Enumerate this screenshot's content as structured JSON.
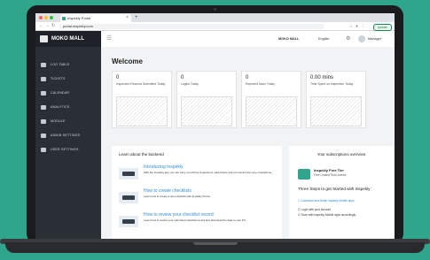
{
  "browser": {
    "tab_title": "Inspekly Portal",
    "url": "portal.inspekly.com",
    "update_label": "Update"
  },
  "app": {
    "brand_name": "MOKO MALL",
    "topbar": {
      "mall": "MOKO MALL",
      "language": "English",
      "user": "Manager"
    },
    "sidebar": [
      {
        "label": "LOG TABLE"
      },
      {
        "label": "TICKETS"
      },
      {
        "label": "CALENDAR"
      },
      {
        "label": "ANALYTICS"
      },
      {
        "label": "MODULE"
      },
      {
        "label": "ADMIN SETTINGS"
      },
      {
        "label": "USER SETTINGS"
      }
    ]
  },
  "main": {
    "welcome": "Welcome",
    "stats": [
      {
        "value": "0",
        "label": "Inspection Records Submitted Today"
      },
      {
        "value": "0",
        "label": "Logins Today"
      },
      {
        "value": "0",
        "label": "Reported Issue Today"
      },
      {
        "value": "0.00 mins",
        "label": "Time Spent on Inspection Today"
      }
    ],
    "learn": {
      "title": "Learn about the backend",
      "items": [
        {
          "title": "Introducing Inspekly",
          "desc": "With the Inspekly app you can carry out off line inspections, add photos and comments from any smartphone."
        },
        {
          "title": "How to create checklists",
          "desc": "Learn how to create a new checklist with Inspekly Portal."
        },
        {
          "title": "How to review your checklist record",
          "desc": "Learn how to review your submitted checklist record and download the data to your PC."
        }
      ]
    },
    "subscription": {
      "title": "Your subscriptions overview",
      "tier_title": "Inspekly Free Tier",
      "tier_sub": "Free Limited Trial License",
      "steps_title": "Three Steps to get Started with Inspekly:",
      "steps": [
        "1. Download and install Inspekly Mobile apps",
        "2. Login with your account",
        "3. Scan with Inspekly Mobile apps accordingly."
      ]
    }
  }
}
